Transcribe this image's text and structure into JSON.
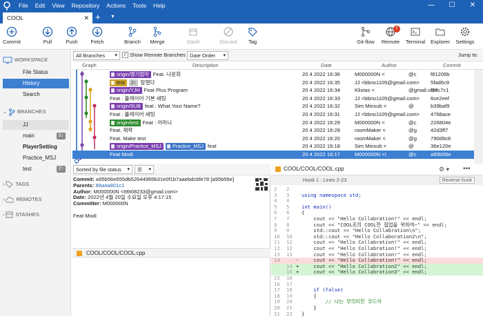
{
  "menu": [
    "File",
    "Edit",
    "View",
    "Repository",
    "Actions",
    "Tools",
    "Help"
  ],
  "tab": {
    "title": "COOL"
  },
  "toolbar": {
    "commit": "Commit",
    "pull": "Pull",
    "push": "Push",
    "fetch": "Fetch",
    "branch": "Branch",
    "merge": "Merge",
    "stash": "Stash",
    "discard": "Discard",
    "tag": "Tag",
    "gitflow": "Git-flow",
    "remote": "Remote",
    "terminal": "Terminal",
    "explorer": "Explorer",
    "settings": "Settings",
    "remote_badge": "!"
  },
  "sidebar": {
    "workspace": "WORKSPACE",
    "file_status": "File Status",
    "history": "History",
    "search": "Search",
    "branches_head": "BRANCHES",
    "branches": [
      {
        "label": "JJ",
        "badge": ""
      },
      {
        "label": "main",
        "badge": "3↓"
      },
      {
        "label": "PlayerSetting",
        "badge": ""
      },
      {
        "label": "Practice_MSJ",
        "badge": ""
      },
      {
        "label": "test",
        "badge": "2↑"
      }
    ],
    "tags": "TAGS",
    "remotes": "REMOTES",
    "stashes": "STASHES"
  },
  "filter": {
    "branches": "All Branches",
    "show_remote": "Show Remote Branches",
    "order": "Date Order",
    "jump": "Jump to:"
  },
  "columns": {
    "graph": "Graph",
    "description": "Description",
    "date": "Date",
    "author": "Author",
    "commit": "Commit"
  },
  "commits": [
    {
      "labels": [
        {
          "t": "origin/명기엄마",
          "c": "purple"
        }
      ],
      "desc": "Feat. 나윤희",
      "date": "20 4 2022 16:36",
      "author": "M000000N <",
      "email": "@c",
      "hash": "f81206b"
    },
    {
      "labels": [
        {
          "t": "test",
          "c": "gold"
        },
        {
          "t": "2↑",
          "c": "gray"
        }
      ],
      "desc": "망했다",
      "date": "20 4 2022 16:35",
      "author": "JJ <bbno1105@gmail.com>",
      "email": "",
      "hash": "5fad6c9"
    },
    {
      "labels": [
        {
          "t": "origin/YJH",
          "c": "purple"
        }
      ],
      "desc": "Feat Plus Program",
      "date": "20 4 2022 16:34",
      "author": "Klistas <",
      "email": "@gmail.com",
      "hash": "f57c7c1"
    },
    {
      "labels": [],
      "desc": "Feat : 플레이어 기본 세팅",
      "date": "20 4 2022 16:33",
      "author": "JJ <bbno1105@gmail.com>",
      "email": "",
      "hash": "6ce2eef"
    },
    {
      "labels": [
        {
          "t": "origin/SUB",
          "c": "purple"
        }
      ],
      "desc": "feat : What Your Name?",
      "date": "20 4 2022 16:32",
      "author": "Sim Minsub <",
      "email": "@",
      "hash": "b39baf9"
    },
    {
      "labels": [],
      "desc": "Feat : 플레이어 세팅",
      "date": "20 4 2022 16:31",
      "author": "JJ <bbno1105@gmail.com>",
      "email": "",
      "hash": "4768ace"
    },
    {
      "labels": [
        {
          "t": "origin/test",
          "c": "green"
        }
      ],
      "desc": "Feat : 어머니",
      "date": "20 4 2022 16:29",
      "author": "M000000N <",
      "email": "@c",
      "hash": "226804e"
    },
    {
      "labels": [],
      "desc": "Feat. 재학",
      "date": "20 4 2022 16:28",
      "author": "roomMaker <",
      "email": "@g",
      "hash": "42d3ff7"
    },
    {
      "labels": [],
      "desc": "Feat. Make test",
      "date": "20 4 2022 16:20",
      "author": "roomMaker <",
      "email": "@g",
      "hash": "790d9c8"
    },
    {
      "labels": [
        {
          "t": "origin/Practice_MSJ",
          "c": "purple"
        },
        {
          "t": "Practice_MSJ",
          "c": "blue"
        }
      ],
      "desc": "feat",
      "date": "20 4 2022 16:18",
      "author": "Sim Minsub <",
      "email": "@",
      "hash": "36e120e"
    },
    {
      "labels": [],
      "desc": "Feat Modi",
      "date": "20 4 2022 16:17",
      "author": "M000000N <!",
      "email": "@c",
      "hash": "a95b56e"
    }
  ],
  "details": {
    "sort": "Sorted by file status",
    "commit_label": "Commit:",
    "commit": "a95b56e655db52644965b31e0f1b7aaebdcbfe78 [a95b56e]",
    "parents_label": "Parents:",
    "parents": "88a4a801c1",
    "author_label": "Author:",
    "author": "M000000N <tt6t08233@gmail.com>",
    "date_label": "Date:",
    "date": "2022년 4월 20일 수요일 오후 4:17:15",
    "committer_label": "Committer:",
    "committer": "M000000N",
    "message": "Feat Modi",
    "file": "COOL/COOL/COOL.cpp"
  },
  "diff": {
    "file": "COOL/COOL/COOL.cpp",
    "hunk": "Hunk 1 : Lines 2-23",
    "reverse": "Reverse hunk",
    "lines": [
      {
        "a": "2",
        "b": "2",
        "t": "ctx",
        "code": ""
      },
      {
        "a": "3",
        "b": "3",
        "t": "ctx",
        "code": "using namespace std;"
      },
      {
        "a": "4",
        "b": "4",
        "t": "ctx",
        "code": ""
      },
      {
        "a": "5",
        "b": "5",
        "t": "ctx",
        "code": "int main()"
      },
      {
        "a": "6",
        "b": "6",
        "t": "ctx",
        "code": "{"
      },
      {
        "a": "7",
        "b": "7",
        "t": "ctx",
        "code": "    cout << \"Hello Collabration!\" << endl;"
      },
      {
        "a": "8",
        "b": "8",
        "t": "ctx",
        "code": "    cout << \"COOL조의 COOL한 협업을 위하여~\" << endl;"
      },
      {
        "a": "9",
        "b": "9",
        "t": "ctx",
        "code": "    std::cout << \"Hello Collabration\\n\";"
      },
      {
        "a": "10",
        "b": "10",
        "t": "ctx",
        "code": "    std::cout << \"Hello Collaboration2\\n\";"
      },
      {
        "a": "11",
        "b": "11",
        "t": "ctx",
        "code": "    cout << \"Hello Collabration!\" << endl;"
      },
      {
        "a": "12",
        "b": "12",
        "t": "ctx",
        "code": "    cout << \"Hello Collabration!\" << endl;"
      },
      {
        "a": "13",
        "b": "13",
        "t": "ctx",
        "code": "    cout << \"Hello Collabration!\" << endl;"
      },
      {
        "a": "14",
        "b": "",
        "t": "del",
        "code": "    cout << \"Hello Collabration!\" << endl;"
      },
      {
        "a": "",
        "b": "14",
        "t": "add",
        "code": "    cout << \"Hello Collabration2\" << endl;"
      },
      {
        "a": "",
        "b": "15",
        "t": "add",
        "code": "    cout << \"Hello Collabration3\" << endl;"
      },
      {
        "a": "15",
        "b": "16",
        "t": "ctx",
        "code": ""
      },
      {
        "a": "16",
        "b": "17",
        "t": "ctx",
        "code": ""
      },
      {
        "a": "17",
        "b": "18",
        "t": "ctx",
        "code": "    if (false)"
      },
      {
        "a": "18",
        "b": "19",
        "t": "ctx",
        "code": "    {"
      },
      {
        "a": "19",
        "b": "20",
        "t": "ctx",
        "code": "        // 나는 무의미한 코드야"
      },
      {
        "a": "20",
        "b": "21",
        "t": "ctx",
        "code": "    }"
      },
      {
        "a": "21",
        "b": "22",
        "t": "ctx",
        "code": "}"
      }
    ]
  },
  "colors": {
    "accent": "#1e62b8",
    "selection": "#3d7fd1",
    "branch_purple": "#7b3fb0",
    "branch_green": "#2e8b2e",
    "add_bg": "#d5f5d5",
    "del_bg": "#fbdcdc"
  }
}
